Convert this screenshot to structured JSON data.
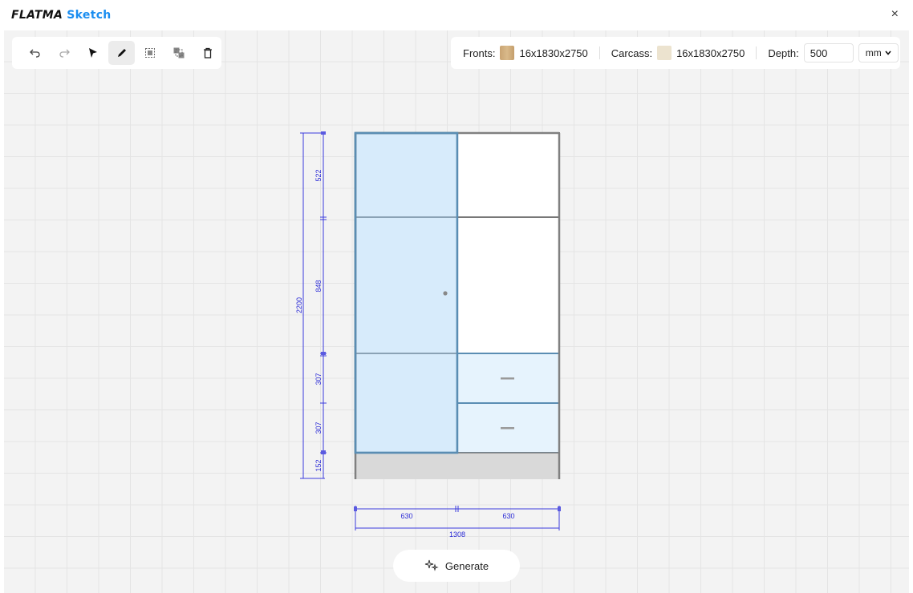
{
  "app": {
    "brand_part1": "FLATMA",
    "brand_part2": "Sketch",
    "close_glyph": "×"
  },
  "toolbar": {
    "tools": [
      {
        "name": "undo-icon",
        "active": false
      },
      {
        "name": "redo-icon",
        "active": false
      },
      {
        "name": "select-pointer-icon",
        "active": false
      },
      {
        "name": "pencil-icon",
        "active": true
      },
      {
        "name": "frame-select-icon",
        "active": false
      },
      {
        "name": "frame-deselect-icon",
        "active": false
      },
      {
        "name": "trash-icon",
        "active": false
      }
    ]
  },
  "properties": {
    "fronts_label": "Fronts:",
    "fronts_value": "16x1830x2750",
    "fronts_color": "#d9b98a",
    "carcass_label": "Carcass:",
    "carcass_value": "16x1830x2750",
    "carcass_color": "#ece3cf",
    "depth_label": "Depth:",
    "depth_value": "500",
    "unit_value": "mm"
  },
  "dimensions": {
    "total_height": "2200",
    "segments": [
      "522",
      "848",
      "307",
      "307",
      "152"
    ],
    "widths": [
      "630",
      "630"
    ],
    "total_width": "1308"
  },
  "colors": {
    "selected_fill": "#d7ebfb",
    "drawer_fill": "#e6f3fd",
    "dimension_color": "#2a2ad6",
    "outline": "#808080",
    "plinth": "#d9d9d9"
  },
  "generate_button": {
    "label": "Generate"
  }
}
